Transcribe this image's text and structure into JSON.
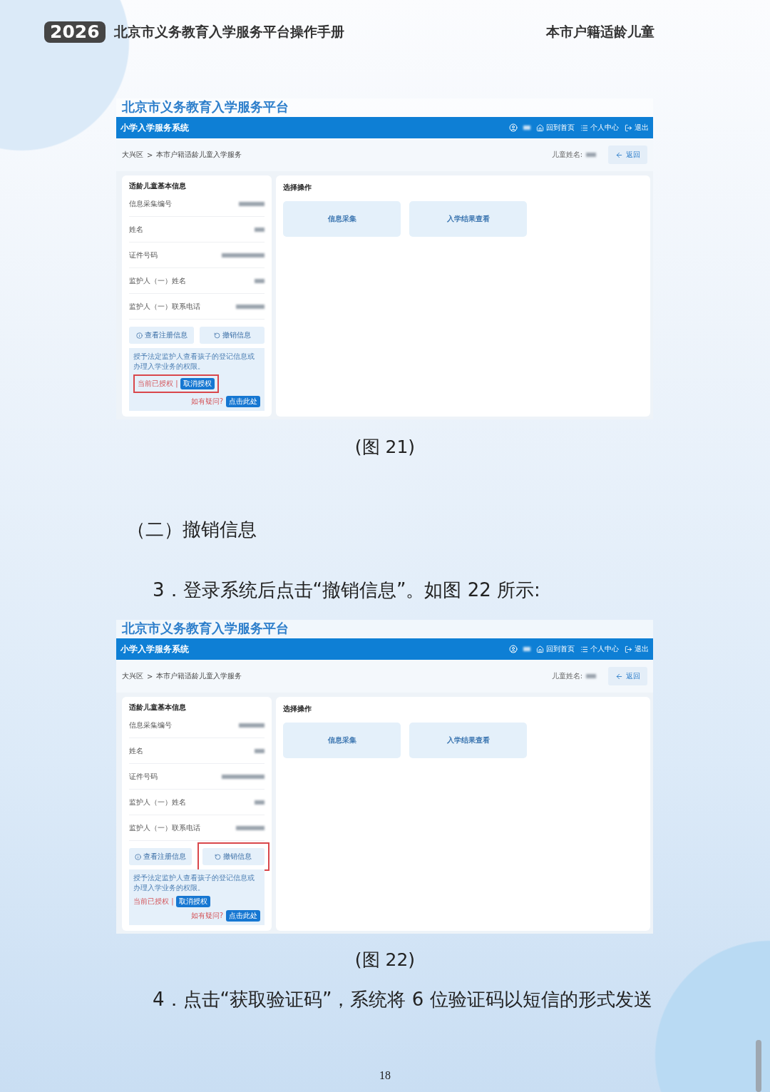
{
  "header": {
    "year": "2026",
    "title": "北京市义务教育入学服务平台操作手册",
    "section": "本市户籍适龄儿童"
  },
  "figures": [
    {
      "platform_title": "北京市义务教育入学服务平台",
      "system_title": "小学入学服务系统",
      "nav": [
        {
          "kind": "home",
          "label": "回到首页"
        },
        {
          "kind": "profile",
          "label": "个人中心"
        },
        {
          "kind": "logout",
          "label": "退出"
        }
      ],
      "breadcrumb": [
        "大兴区",
        ">",
        "本市户籍适龄儿童入学服务"
      ],
      "child_name_label": "儿童姓名:",
      "back": "返回",
      "info_title": "适龄儿童基本信息",
      "info_rows": [
        "信息采集编号",
        "姓名",
        "证件号码",
        "监护人（一）姓名",
        "监护人（一）联系电话"
      ],
      "view_button": "查看注册信息",
      "revoke_button": "撤销信息",
      "notice": "授予法定监护人查看孩子的登记信息或办理入学业务的权限。",
      "auth_status": "当前已授权 |",
      "cancel_auth": "取消授权",
      "help": "如有疑问?",
      "help_link": "点击此处",
      "actions_title": "选择操作",
      "actions": [
        "信息采集",
        "入学结果查看"
      ],
      "auth_highlighted": true,
      "revoke_highlighted": false,
      "caption": "(图 21)"
    },
    {
      "platform_title": "北京市义务教育入学服务平台",
      "system_title": "小学入学服务系统",
      "nav": [
        {
          "kind": "home",
          "label": "回到首页"
        },
        {
          "kind": "profile",
          "label": "个人中心"
        },
        {
          "kind": "logout",
          "label": "退出"
        }
      ],
      "breadcrumb": [
        "大兴区",
        ">",
        "本市户籍适龄儿童入学服务"
      ],
      "child_name_label": "儿童姓名:",
      "back": "返回",
      "info_title": "适龄儿童基本信息",
      "info_rows": [
        "信息采集编号",
        "姓名",
        "证件号码",
        "监护人（一）姓名",
        "监护人（一）联系电话"
      ],
      "view_button": "查看注册信息",
      "revoke_button": "撤销信息",
      "notice": "授予法定监护人查看孩子的登记信息或办理入学业务的权限。",
      "auth_status": "当前已授权 |",
      "cancel_auth": "取消授权",
      "help": "如有疑问?",
      "help_link": "点击此处",
      "actions_title": "选择操作",
      "actions": [
        "信息采集",
        "入学结果查看"
      ],
      "auth_highlighted": false,
      "revoke_highlighted": true,
      "caption": "(图 22)"
    }
  ],
  "section_heading": "（二）撤销信息",
  "step_3": "3．登录系统后点击“撤销信息”。如图 22 所示:",
  "step_4": "4．点击“获取验证码”，系统将 6 位验证码以短信的形式发送",
  "page_number": "18"
}
